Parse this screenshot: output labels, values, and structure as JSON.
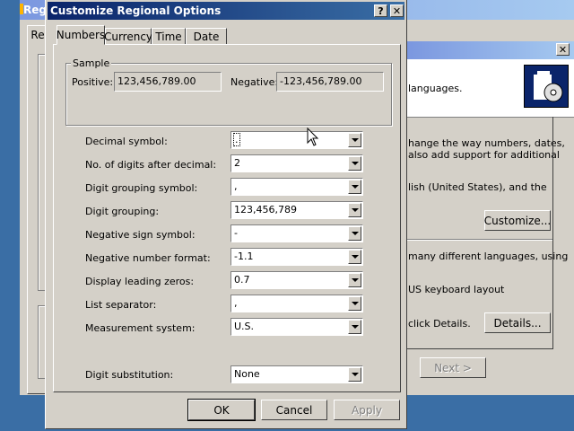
{
  "background_window": {
    "title_fragment": "Regi",
    "tab_fragment": "Re",
    "text_lines": [
      "languages.",
      "hange the way numbers, dates,",
      "also add support for additional",
      "lish (United States), and the",
      "many different languages, using",
      "US keyboard layout",
      "click Details."
    ],
    "customize_label": "Customize...",
    "details_label": "Details...",
    "next_label": "Next >"
  },
  "dialog": {
    "title": "Customize Regional Options",
    "help_glyph": "?",
    "close_glyph": "✕",
    "tabs": [
      "Numbers",
      "Currency",
      "Time",
      "Date"
    ],
    "sample": {
      "group_label": "Sample",
      "positive_label": "Positive:",
      "positive_value": "123,456,789.00",
      "negative_label": "Negative:",
      "negative_value": "-123,456,789.00"
    },
    "fields": [
      {
        "label": "Decimal symbol:",
        "value": "."
      },
      {
        "label": "No. of digits after decimal:",
        "value": "2"
      },
      {
        "label": "Digit grouping symbol:",
        "value": ","
      },
      {
        "label": "Digit grouping:",
        "value": "123,456,789"
      },
      {
        "label": "Negative sign symbol:",
        "value": "-"
      },
      {
        "label": "Negative number format:",
        "value": "-1.1"
      },
      {
        "label": "Display leading zeros:",
        "value": "0.7"
      },
      {
        "label": "List separator:",
        "value": ","
      },
      {
        "label": "Measurement system:",
        "value": "U.S."
      },
      {
        "label": "Digit substitution:",
        "value": "None"
      }
    ],
    "ok_label": "OK",
    "cancel_label": "Cancel",
    "apply_label": "Apply"
  }
}
